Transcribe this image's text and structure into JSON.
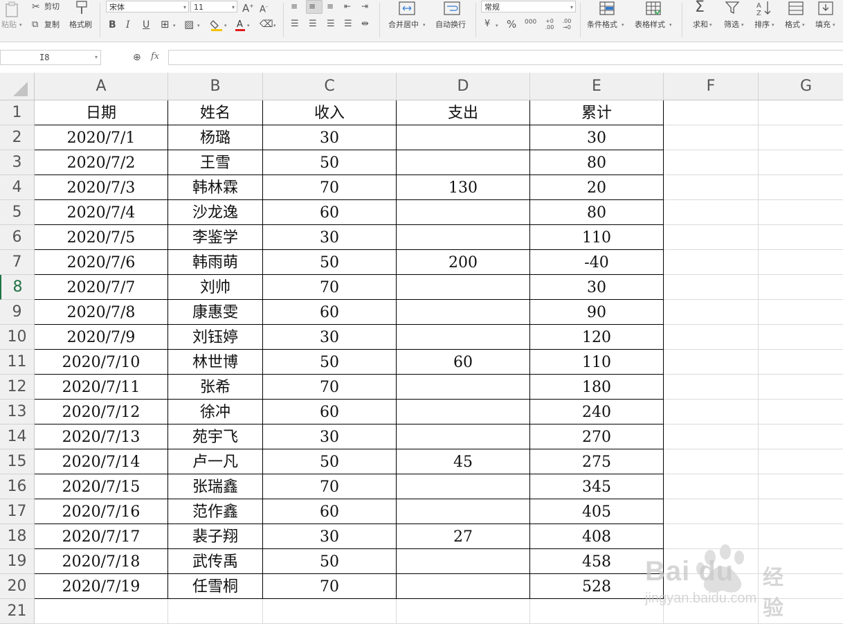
{
  "ribbon": {
    "paste": "粘贴",
    "cut": "剪切",
    "copy": "复制",
    "format_painter": "格式刷",
    "font_name": "宋体",
    "font_size": "11",
    "number_format": "常规",
    "merge_center": "合并居中",
    "wrap_text": "自动换行",
    "conditional_format": "条件格式",
    "table_style": "表格样式",
    "sum": "求和",
    "filter": "筛选",
    "sort": "排序",
    "format": "格式",
    "fill": "填充",
    "bold": "B",
    "italic": "I",
    "underline": "U",
    "percent": "%",
    "thousands": "000",
    "inc_decimal": "+0 .00",
    "dec_decimal": ".00 →0",
    "currency": "¥"
  },
  "formula_bar": {
    "name_box": "I8",
    "fx": "fx",
    "formula": ""
  },
  "sheet": {
    "columns": [
      "A",
      "B",
      "C",
      "D",
      "E",
      "F",
      "G"
    ],
    "rows": [
      [
        "日期",
        "姓名",
        "收入",
        "支出",
        "累计"
      ],
      [
        "2020/7/1",
        "杨璐",
        "30",
        "",
        "30"
      ],
      [
        "2020/7/2",
        "王雪",
        "50",
        "",
        "80"
      ],
      [
        "2020/7/3",
        "韩林霖",
        "70",
        "130",
        "20"
      ],
      [
        "2020/7/4",
        "沙龙逸",
        "60",
        "",
        "80"
      ],
      [
        "2020/7/5",
        "李鉴学",
        "30",
        "",
        "110"
      ],
      [
        "2020/7/6",
        "韩雨萌",
        "50",
        "200",
        "-40"
      ],
      [
        "2020/7/7",
        "刘帅",
        "70",
        "",
        "30"
      ],
      [
        "2020/7/8",
        "康惠雯",
        "60",
        "",
        "90"
      ],
      [
        "2020/7/9",
        "刘钰婷",
        "30",
        "",
        "120"
      ],
      [
        "2020/7/10",
        "林世博",
        "50",
        "60",
        "110"
      ],
      [
        "2020/7/11",
        "张希",
        "70",
        "",
        "180"
      ],
      [
        "2020/7/12",
        "徐冲",
        "60",
        "",
        "240"
      ],
      [
        "2020/7/13",
        "苑宇飞",
        "30",
        "",
        "270"
      ],
      [
        "2020/7/14",
        "卢一凡",
        "50",
        "45",
        "275"
      ],
      [
        "2020/7/15",
        "张瑞鑫",
        "70",
        "",
        "345"
      ],
      [
        "2020/7/16",
        "范作鑫",
        "60",
        "",
        "405"
      ],
      [
        "2020/7/17",
        "裴子翔",
        "30",
        "27",
        "408"
      ],
      [
        "2020/7/18",
        "武传禹",
        "50",
        "",
        "458"
      ],
      [
        "2020/7/19",
        "任雪桐",
        "70",
        "",
        "528"
      ]
    ],
    "row_count_shown": 21,
    "selected_row": 8
  },
  "watermark": {
    "brand": "Bai du",
    "text": "经验",
    "url": "jingyan.baidu.com"
  },
  "colors": {
    "accent": "#217346",
    "ribbon_bg": "#f3f3f3",
    "header_bg": "#f0f0f0"
  }
}
